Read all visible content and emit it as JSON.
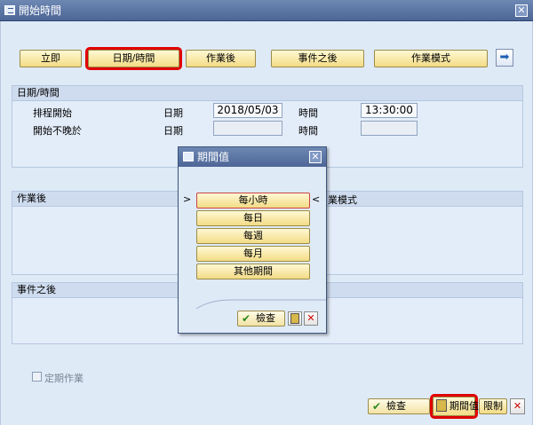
{
  "window": {
    "title": "開始時間",
    "close": "✕"
  },
  "toolbar": {
    "immediate": "立即",
    "date_time": "日期/時間",
    "after_job": "作業後",
    "after_event": "事件之後",
    "job_pattern": "作業模式",
    "next_arrow": "➡"
  },
  "datetime_group": {
    "header": "日期/時間",
    "sched_start_label": "排程開始",
    "no_later_label": "開始不晚於",
    "date_label": "日期",
    "time_label": "時間",
    "sched_date": "2018/05/03",
    "sched_time": "13:30:00",
    "no_later_date": "",
    "no_later_time": ""
  },
  "after_job_group": {
    "header": "作業後",
    "pattern_header_partial": "業模式"
  },
  "after_event_group": {
    "header": "事件之後"
  },
  "periodic": {
    "label": "定期作業",
    "checked": false
  },
  "footer": {
    "check": "檢查",
    "period_value": "期間值",
    "restrict": "限制",
    "cancel": "✕"
  },
  "dialog": {
    "title": "期間值",
    "close": "✕",
    "marker_left": ">",
    "marker_right": "<",
    "options": [
      "每小時",
      "每日",
      "每週",
      "每月",
      "其他期間"
    ],
    "check": "檢查",
    "cancel": "✕"
  },
  "colors": {
    "title_bar": "#4d6696",
    "button_yellow": "#f3dc86",
    "highlight_red": "#e00000",
    "panel_blue": "#dfeaf7"
  }
}
